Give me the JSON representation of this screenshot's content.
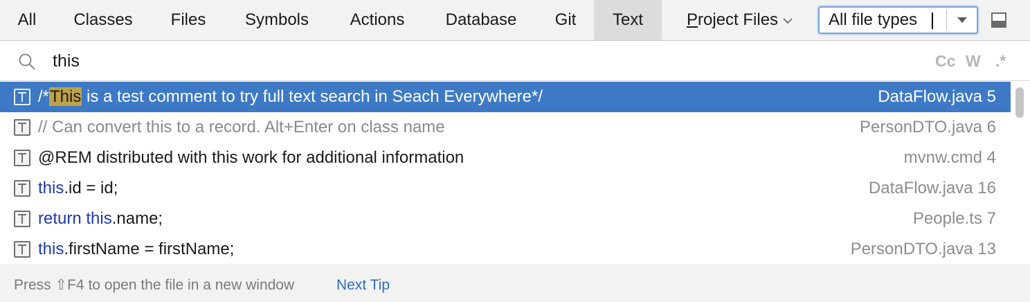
{
  "tabs": [
    {
      "label": "All"
    },
    {
      "label": "Classes"
    },
    {
      "label": "Files"
    },
    {
      "label": "Symbols"
    },
    {
      "label": "Actions"
    },
    {
      "label": "Database"
    },
    {
      "label": "Git"
    },
    {
      "label": "Text",
      "active": true
    }
  ],
  "scope": {
    "label_mnemonic": "P",
    "label_rest": "roject Files"
  },
  "filetype": {
    "value": "All file types"
  },
  "search": {
    "value": "this",
    "options": {
      "case": "Cc",
      "words": "W",
      "regex": ".*"
    }
  },
  "results": [
    {
      "pre": "/*",
      "highlight": "This",
      "rest": " is a test comment to try full text search in Seach Everywhere*/",
      "file": "DataFlow.java 5",
      "selected": true
    },
    {
      "text": "// Can convert this to a record. Alt+Enter on class name",
      "file": "PersonDTO.java 6"
    },
    {
      "text": "@REM distributed with this work for additional information",
      "file": "mvnw.cmd 4"
    },
    {
      "kw": "this",
      "rest": ".id = id;",
      "file": "DataFlow.java 16"
    },
    {
      "kw": "return this",
      "rest": ".name;",
      "file": "People.ts 7"
    },
    {
      "kw": "this",
      "rest": ".firstName = firstName;",
      "file": "PersonDTO.java 13"
    }
  ],
  "footer": {
    "tip": "Press ⇧F4 to open the file in a new window",
    "link": "Next Tip"
  },
  "colors": {
    "selection": "#3d79c5",
    "keyword": "#1d39a8",
    "match_highlight": "#bfa246",
    "link": "#2f6cc0"
  }
}
